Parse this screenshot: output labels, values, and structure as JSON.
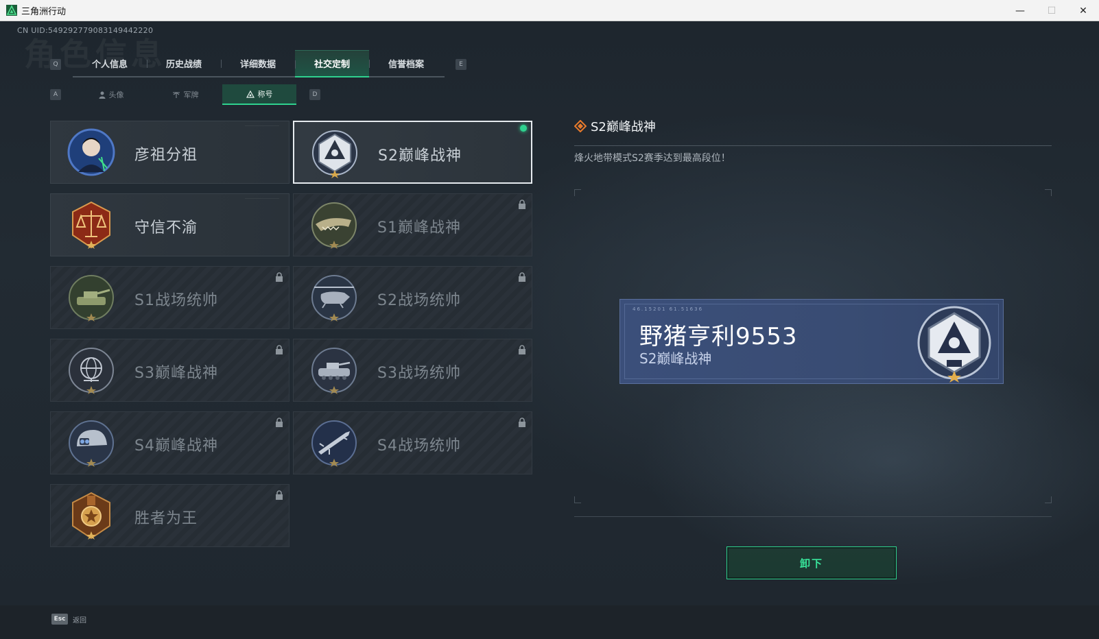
{
  "window": {
    "title": "三角洲行动",
    "controls": [
      "—",
      "☐",
      "✕"
    ]
  },
  "header": {
    "uid": "CN UID:549292779083149442220",
    "bg_title": "角色信息"
  },
  "key_hints": {
    "main_left": "Q",
    "main_right": "E",
    "sub_left": "A",
    "sub_right": "D"
  },
  "main_tabs": [
    {
      "label": "个人信息"
    },
    {
      "label": "历史战绩"
    },
    {
      "label": "详细数据"
    },
    {
      "label": "社交定制",
      "active": true
    },
    {
      "label": "信誉档案"
    }
  ],
  "sub_tabs": [
    {
      "label": "头像",
      "icon": "person-icon"
    },
    {
      "label": "军牌",
      "icon": "dog-tag-icon"
    },
    {
      "label": "称号",
      "icon": "title-emblem-icon",
      "active": true
    }
  ],
  "titles": [
    {
      "name": "彦祖分祖",
      "locked": false,
      "badge": "portrait-badge"
    },
    {
      "name": "S2巅峰战神",
      "locked": false,
      "selected": true,
      "badge": "peak-badge"
    },
    {
      "name": "守信不渝",
      "locked": false,
      "badge": "scales-badge"
    },
    {
      "name": "S1巅峰战神",
      "locked": true,
      "badge": "crocodile-badge"
    },
    {
      "name": "S1战场统帅",
      "locked": true,
      "badge": "tank-badge"
    },
    {
      "name": "S2战场统帅",
      "locked": true,
      "badge": "helicopter-badge"
    },
    {
      "name": "S3巅峰战神",
      "locked": true,
      "badge": "globe-badge"
    },
    {
      "name": "S3战场统帅",
      "locked": true,
      "badge": "armored-vehicle-badge"
    },
    {
      "name": "S4巅峰战神",
      "locked": true,
      "badge": "helmet-badge"
    },
    {
      "name": "S4战场统帅",
      "locked": true,
      "badge": "missile-badge"
    },
    {
      "name": "胜者为王",
      "locked": true,
      "badge": "medal-badge"
    }
  ],
  "detail": {
    "title": "S2巅峰战神",
    "description": "烽火地带模式S2赛季达到最高段位！",
    "nameplate": {
      "code": "46.15201 61.51636",
      "player_name": "野猪亨利9553",
      "player_title": "S2巅峰战神"
    },
    "unequip_label": "卸下"
  },
  "footer": {
    "esc_key": "Esc",
    "esc_label": "返回"
  },
  "colors": {
    "accent": "#2fd28f",
    "background": "#1e262e",
    "nameplate": "#3b4f7a"
  }
}
